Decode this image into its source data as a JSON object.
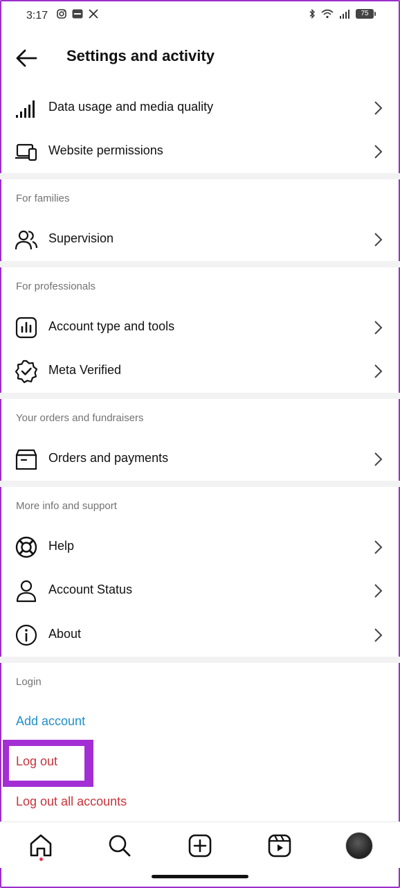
{
  "status_bar": {
    "time": "3:17",
    "battery": "75"
  },
  "header": {
    "title": "Settings and activity"
  },
  "rows_top": [
    {
      "label": "Data usage and media quality",
      "icon": "signal-bars-icon"
    },
    {
      "label": "Website permissions",
      "icon": "devices-icon"
    }
  ],
  "sections": {
    "families": {
      "title": "For families",
      "items": [
        {
          "label": "Supervision",
          "icon": "people-icon"
        }
      ]
    },
    "professionals": {
      "title": "For professionals",
      "items": [
        {
          "label": "Account type and tools",
          "icon": "chart-icon"
        },
        {
          "label": "Meta Verified",
          "icon": "verified-badge-icon"
        }
      ]
    },
    "orders": {
      "title": "Your orders and fundraisers",
      "items": [
        {
          "label": "Orders and payments",
          "icon": "box-icon"
        }
      ]
    },
    "support": {
      "title": "More info and support",
      "items": [
        {
          "label": "Help",
          "icon": "lifebuoy-icon"
        },
        {
          "label": "Account Status",
          "icon": "person-icon"
        },
        {
          "label": "About",
          "icon": "info-icon"
        }
      ]
    },
    "login": {
      "title": "Login",
      "add_account": "Add account",
      "log_out": "Log out",
      "log_out_all": "Log out all accounts"
    }
  },
  "colors": {
    "link_blue": "#1f8fc8",
    "logout_red": "#c7343b",
    "highlight_purple": "#a32fd4",
    "section_gray": "#737373",
    "notification_dot": "#e0304b"
  },
  "bottom_nav": [
    "home-icon",
    "search-icon",
    "create-icon",
    "reels-icon",
    "profile-avatar"
  ]
}
